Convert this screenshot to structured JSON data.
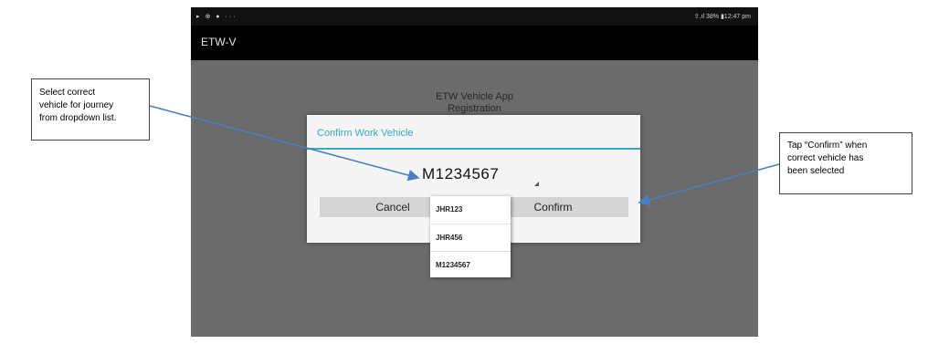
{
  "status_bar": {
    "left_icons": "▸ ⊕ ● ···",
    "right_text": "⇧.ıl 38% ▮12:47 pm"
  },
  "app_bar": {
    "title": "ETW-V"
  },
  "background": {
    "heading_line1": "ETW Vehicle App",
    "heading_line2": "Registration"
  },
  "dialog": {
    "title": "Confirm Work Vehicle",
    "selected_vehicle": "M1234567",
    "cancel_label": "Cancel",
    "confirm_label": "Confirm"
  },
  "dropdown": {
    "options": [
      "JHR123",
      "JHR456",
      "M1234567"
    ]
  },
  "annotations": {
    "left": [
      "Select correct",
      "vehicle for journey",
      "from dropdown list."
    ],
    "right": [
      "Tap “Confirm” when",
      "correct vehicle has",
      "been selected"
    ]
  },
  "colors": {
    "accent": "#33a9cc",
    "arrow": "#4a7fc1",
    "overlay": "#6b6b6b"
  }
}
